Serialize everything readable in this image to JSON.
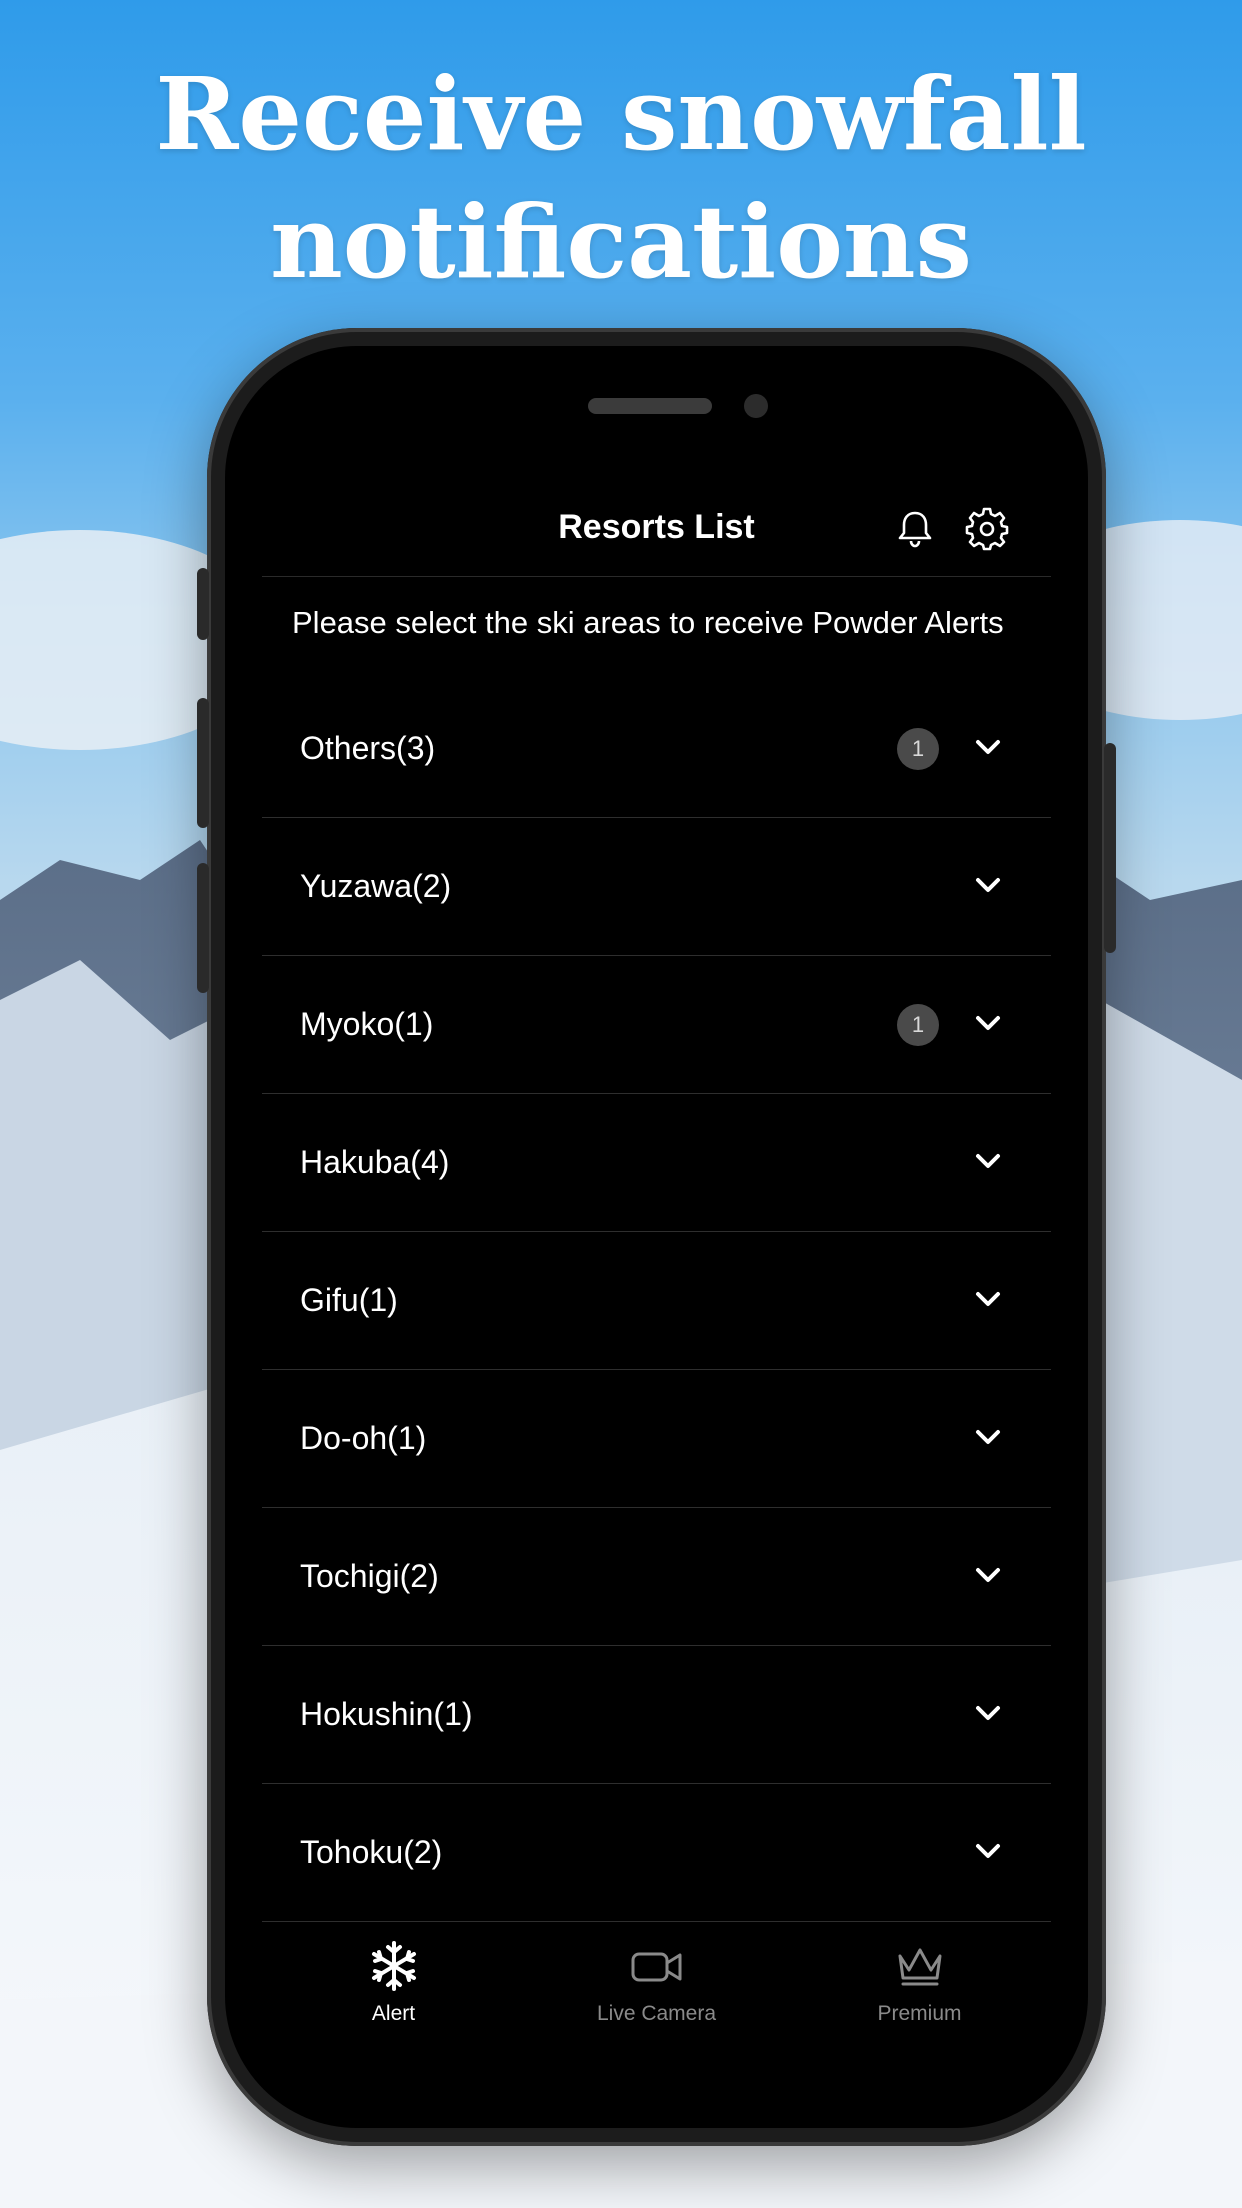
{
  "headline": {
    "line1": "Receive snowfall",
    "line2": "notifications"
  },
  "app": {
    "title": "Resorts List",
    "intro": "Please select the ski areas to receive Powder Alerts",
    "icons": {
      "bell": "bell-icon",
      "settings": "gear-icon"
    },
    "regions": [
      {
        "label": "Others(3)",
        "badge": "1"
      },
      {
        "label": "Yuzawa(2)",
        "badge": null
      },
      {
        "label": "Myoko(1)",
        "badge": "1"
      },
      {
        "label": "Hakuba(4)",
        "badge": null
      },
      {
        "label": "Gifu(1)",
        "badge": null
      },
      {
        "label": "Do-oh(1)",
        "badge": null
      },
      {
        "label": "Tochigi(2)",
        "badge": null
      },
      {
        "label": "Hokushin(1)",
        "badge": null
      },
      {
        "label": "Tohoku(2)",
        "badge": null
      }
    ],
    "tabs": [
      {
        "label": "Alert",
        "icon": "snowflake-icon",
        "active": true
      },
      {
        "label": "Live Camera",
        "icon": "video-camera-icon",
        "active": false
      },
      {
        "label": "Premium",
        "icon": "crown-icon",
        "active": false
      }
    ]
  },
  "colors": {
    "active_tab": "#ffffff",
    "inactive_tab": "#8a8a8a",
    "badge_bg": "#4a4a4a"
  }
}
